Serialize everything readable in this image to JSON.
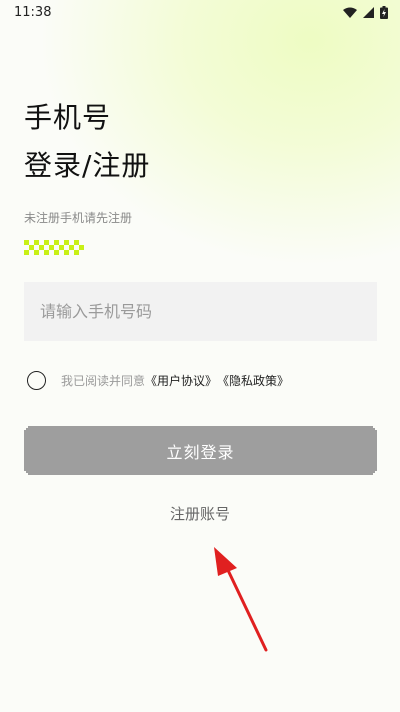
{
  "status_bar": {
    "time": "11:38",
    "icons": [
      "wifi-icon",
      "cell-signal-icon",
      "battery-charging-icon"
    ]
  },
  "title": {
    "line1": "手机号",
    "line2": "登录/注册"
  },
  "hint": "未注册手机请先注册",
  "phone_input": {
    "placeholder": "请输入手机号码",
    "value": ""
  },
  "agreement": {
    "checked": false,
    "prefix": "我已阅读并同意",
    "user_agreement": "《用户协议》",
    "privacy_policy": "《隐私政策》"
  },
  "login_button": {
    "label": "立刻登录"
  },
  "register_link": {
    "label": "注册账号"
  },
  "colors": {
    "accent": "#c8f016",
    "button_disabled": "#9e9e9e",
    "annotation_arrow": "#e02020"
  }
}
